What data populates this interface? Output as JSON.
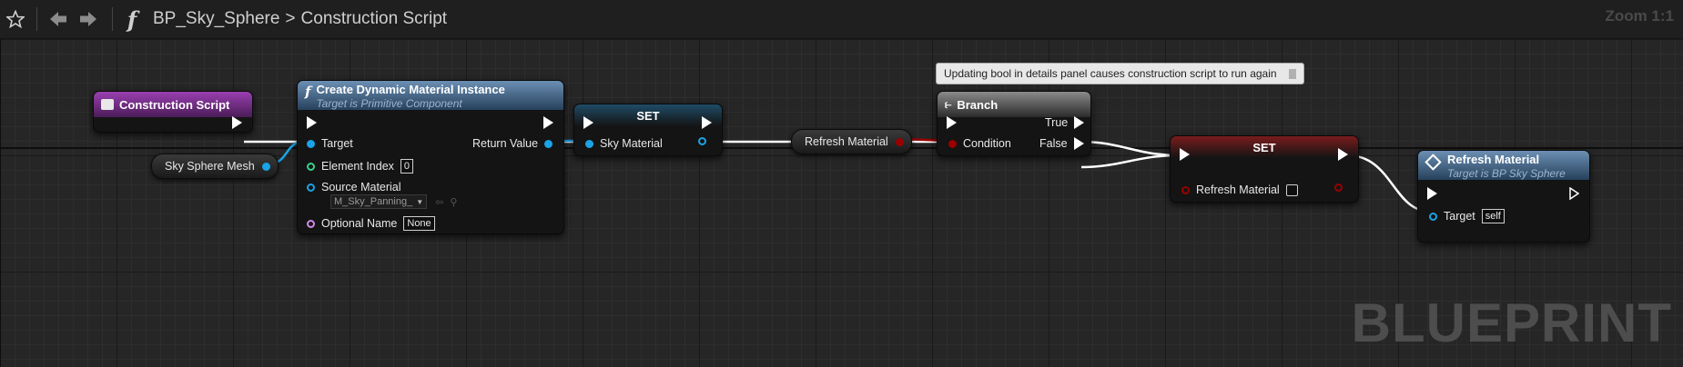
{
  "toolbar": {
    "star_icon": "star-icon",
    "back_icon": "arrow-left-icon",
    "forward_icon": "arrow-right-icon",
    "function_icon_label": "f",
    "breadcrumb_root": "BP_Sky_Sphere",
    "breadcrumb_separator": ">",
    "breadcrumb_current": "Construction Script",
    "zoom": "Zoom 1:1"
  },
  "watermark": "BLUEPRINT",
  "comment": "Updating bool in details panel causes construction script to run again",
  "nodes": {
    "construction_script": {
      "title": "Construction Script"
    },
    "create_dmi": {
      "title": "Create Dynamic Material Instance",
      "subtitle": "Target is Primitive Component",
      "pin_target": "Target",
      "pin_element_index": "Element Index",
      "element_index_value": "0",
      "pin_source_material": "Source Material",
      "source_material_value": "M_Sky_Panning_",
      "pin_optional_name": "Optional Name",
      "optional_name_value": "None",
      "pin_return_value": "Return Value"
    },
    "set_sky": {
      "title": "SET",
      "pin_sky_material": "Sky Material"
    },
    "sky_sphere_mesh": {
      "label": "Sky Sphere Mesh"
    },
    "refresh_material_var": {
      "label": "Refresh Material"
    },
    "branch": {
      "title": "Branch",
      "pin_condition": "Condition",
      "pin_true": "True",
      "pin_false": "False"
    },
    "set_refresh": {
      "title": "SET",
      "pin_refresh_material": "Refresh Material"
    },
    "refresh_material_fn": {
      "title": "Refresh Material",
      "subtitle": "Target is BP Sky Sphere",
      "pin_target": "Target",
      "target_value": "self"
    }
  },
  "colors": {
    "exec": "#ffffff",
    "object_pin": "#1aa3e6",
    "int_pin": "#37d38e",
    "name_pin": "#d08ae8",
    "bool_pin": "#9a0000"
  }
}
